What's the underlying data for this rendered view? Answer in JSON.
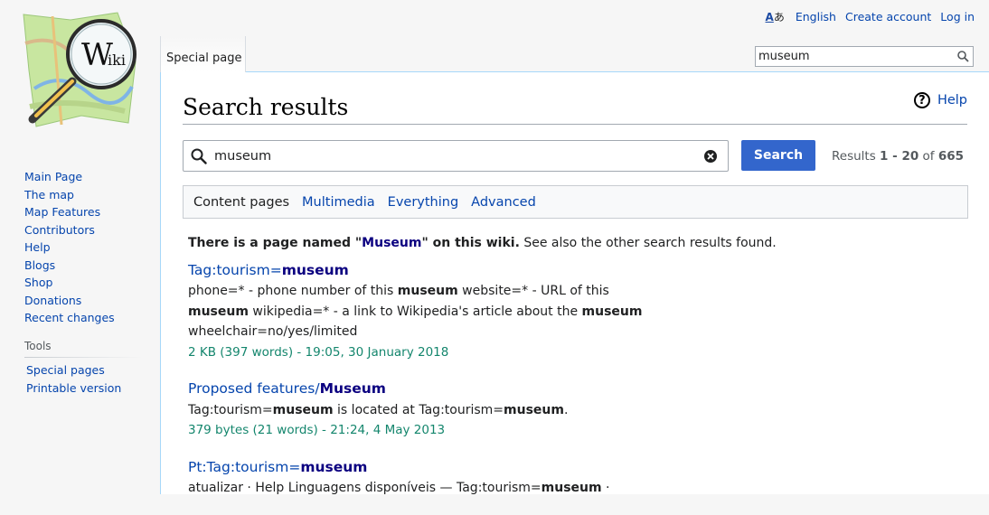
{
  "personal": {
    "language": "English",
    "create_account": "Create account",
    "login": "Log in"
  },
  "logo": {
    "text_w": "W",
    "text_iki": "iki"
  },
  "nav": {
    "items": [
      "Main Page",
      "The map",
      "Map Features",
      "Contributors",
      "Help",
      "Blogs",
      "Shop",
      "Donations",
      "Recent changes"
    ]
  },
  "tools": {
    "heading": "Tools",
    "items": [
      "Special pages",
      "Printable version"
    ]
  },
  "header": {
    "tab": "Special page",
    "search_value": "museum"
  },
  "page": {
    "title": "Search results",
    "help": "Help",
    "search_value": "museum",
    "search_button": "Search",
    "results_prefix": "Results ",
    "results_range": "1 - 20",
    "results_of": " of ",
    "results_total": "665",
    "tabs": [
      "Content pages",
      "Multimedia",
      "Everything",
      "Advanced"
    ],
    "notice_before": "There is a page named \"",
    "notice_link": "Museum",
    "notice_after": "\" on this wiki.",
    "notice_tail": " See also the other search results found."
  },
  "results": [
    {
      "title_prefix": "Tag:tourism=",
      "title_bold": "museum",
      "lines": [
        [
          "phone=* - phone number of this ",
          "museum",
          " website=* - URL of this"
        ],
        [
          "",
          "museum",
          " wikipedia=* - a link to Wikipedia's article about the ",
          "museum"
        ],
        [
          "wheelchair=no/yes/limited"
        ]
      ],
      "meta": "2 KB (397 words) - 19:05, 30 January 2018"
    },
    {
      "title_prefix": "Proposed features/",
      "title_bold": "Museum",
      "lines": [
        [
          "Tag:tourism=",
          "museum",
          " is located at Tag:tourism=",
          "museum",
          "."
        ]
      ],
      "meta": "379 bytes (21 words) - 21:24, 4 May 2013"
    },
    {
      "title_prefix": "Pt:Tag:tourism=",
      "title_bold": "museum",
      "lines": [
        [
          "atualizar · Help Linguagens disponíveis — Tag:tourism=",
          "museum",
          " ·"
        ]
      ],
      "meta": ""
    }
  ],
  "colors": {
    "link": "#0645ad",
    "visited_bold": "#0b0080",
    "meta_green": "#14866d",
    "button_blue": "#3366cc"
  }
}
